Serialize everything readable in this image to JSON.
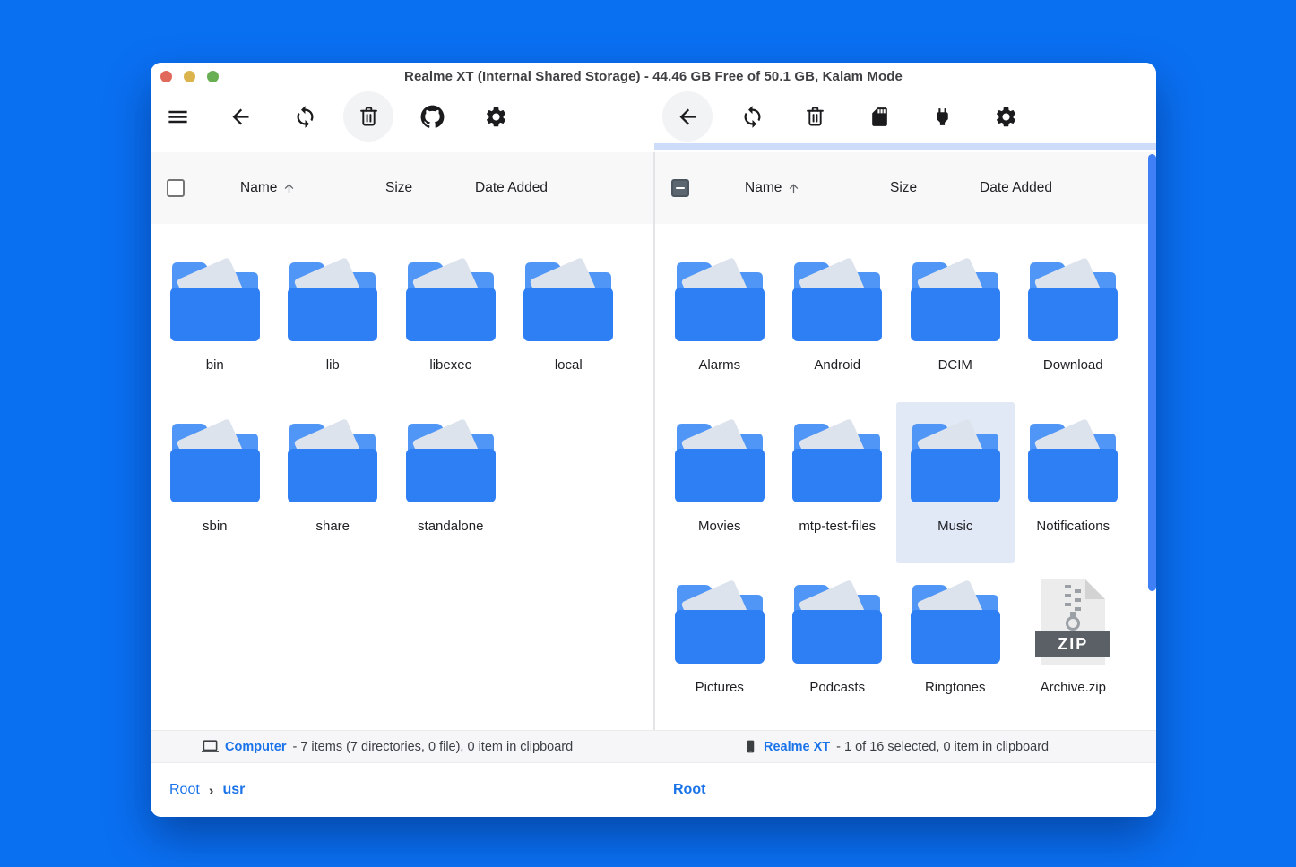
{
  "window": {
    "title": "Realme XT (Internal Shared Storage) - 44.46 GB Free of 50.1 GB, Kalam Mode"
  },
  "colors": {
    "desktop_background": "#0a70f2",
    "accent_link": "#1a73e8",
    "folder_front": "#2e7ef4",
    "folder_back": "#4f96f6",
    "folder_paper": "#dde3ed",
    "selection_background": "#e2e9f6",
    "progress_strip": "#cddcf8",
    "scrollbar_thumb": "#3f80f7",
    "zip_banner": "#5b6067",
    "traffic_red": "#e0695c",
    "traffic_yellow": "#dcb44e",
    "traffic_green": "#68ae53"
  },
  "left_pane": {
    "toolbar_icons": [
      "menu-icon",
      "back-icon",
      "refresh-icon",
      "delete-icon",
      "github-icon",
      "settings-icon"
    ],
    "toolbar_highlighted": "delete-icon",
    "header": {
      "name": "Name",
      "size": "Size",
      "date_added": "Date Added",
      "sort": "ascending",
      "checkbox_state": "unchecked"
    },
    "items": [
      {
        "label": "bin",
        "type": "folder"
      },
      {
        "label": "lib",
        "type": "folder"
      },
      {
        "label": "libexec",
        "type": "folder"
      },
      {
        "label": "local",
        "type": "folder"
      },
      {
        "label": "sbin",
        "type": "folder"
      },
      {
        "label": "share",
        "type": "folder"
      },
      {
        "label": "standalone",
        "type": "folder"
      }
    ],
    "status": {
      "icon": "laptop-icon",
      "device_label": "Computer",
      "detail": "- 7 items (7 directories, 0 file), 0 item in clipboard"
    },
    "breadcrumb": [
      {
        "label": "Root"
      },
      {
        "label": "usr",
        "current": true
      }
    ]
  },
  "right_pane": {
    "toolbar_icons": [
      "back-icon",
      "refresh-icon",
      "delete-icon",
      "sd-card-icon",
      "usb-plug-icon",
      "settings-icon"
    ],
    "toolbar_highlighted": "back-icon",
    "header": {
      "name": "Name",
      "size": "Size",
      "date_added": "Date Added",
      "sort": "ascending",
      "checkbox_state": "indeterminate"
    },
    "items": [
      {
        "label": "Alarms",
        "type": "folder"
      },
      {
        "label": "Android",
        "type": "folder"
      },
      {
        "label": "DCIM",
        "type": "folder"
      },
      {
        "label": "Download",
        "type": "folder"
      },
      {
        "label": "Movies",
        "type": "folder"
      },
      {
        "label": "mtp-test-files",
        "type": "folder"
      },
      {
        "label": "Music",
        "type": "folder",
        "selected": true
      },
      {
        "label": "Notifications",
        "type": "folder"
      },
      {
        "label": "Pictures",
        "type": "folder"
      },
      {
        "label": "Podcasts",
        "type": "folder"
      },
      {
        "label": "Ringtones",
        "type": "folder"
      },
      {
        "label": "Archive.zip",
        "type": "zip",
        "badge": "ZIP"
      }
    ],
    "status": {
      "icon": "smartphone-icon",
      "device_label": "Realme XT",
      "detail": "- 1 of 16 selected, 0 item in clipboard"
    },
    "breadcrumb": [
      {
        "label": "Root",
        "current": true
      }
    ]
  }
}
